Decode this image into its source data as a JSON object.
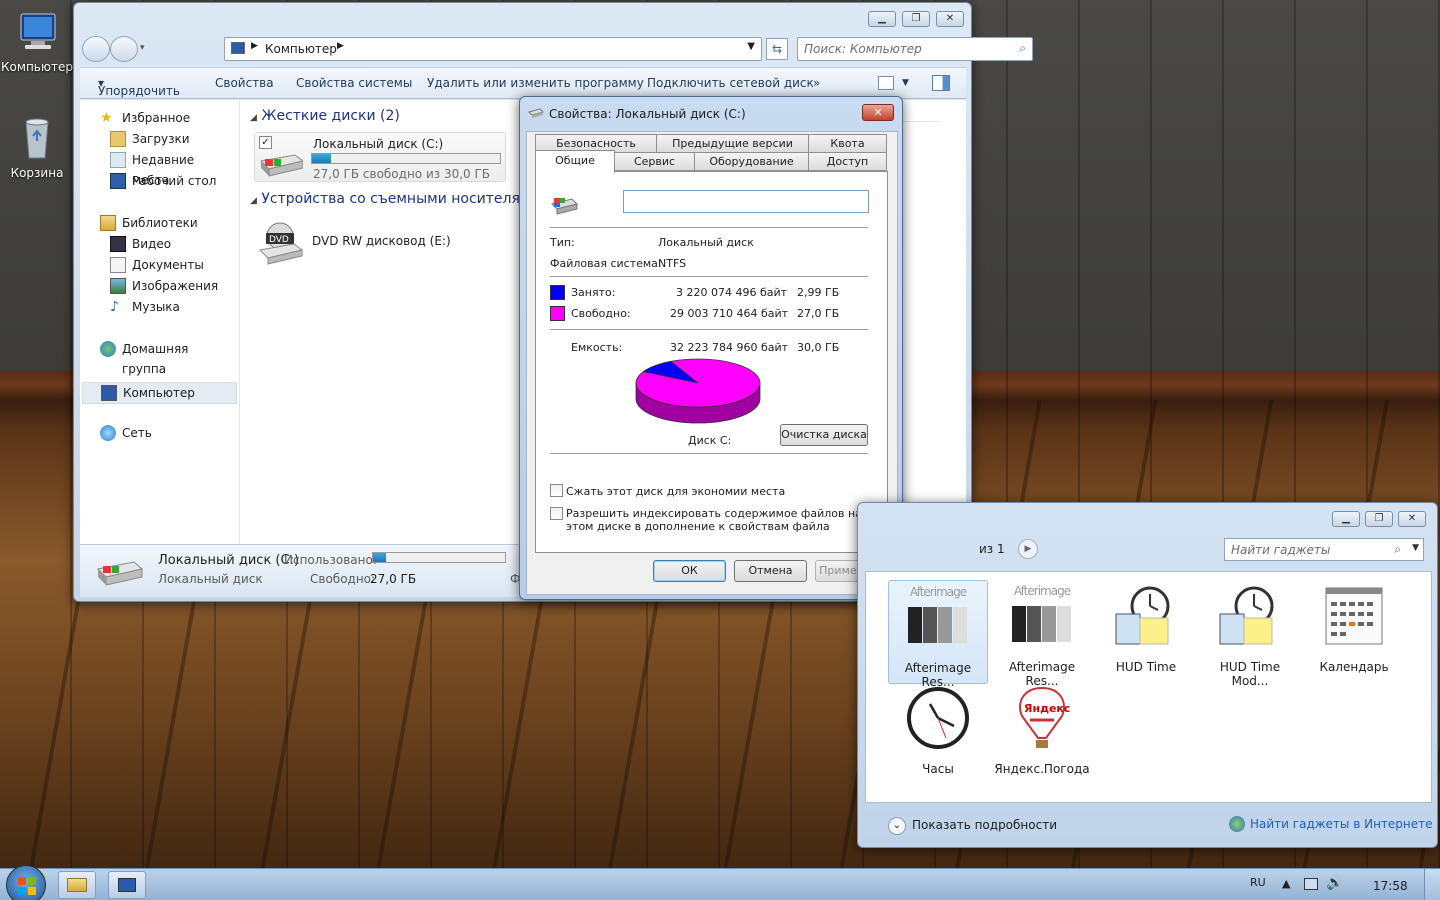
{
  "desktop": {
    "icons": [
      {
        "label": "Компьютер",
        "icon": "computer-icon"
      },
      {
        "label": "Корзина",
        "icon": "recycle-bin-icon"
      }
    ]
  },
  "explorer": {
    "breadcrumb": "Компьютер",
    "search_placeholder": "Поиск: Компьютер",
    "toolbar": [
      "Упорядочить",
      "Свойства",
      "Свойства системы",
      "Удалить или изменить программу",
      "Подключить сетевой диск",
      "»"
    ],
    "nav": {
      "favorites": "Избранное",
      "fav_items": [
        "Загрузки",
        "Недавние места",
        "Рабочий стол"
      ],
      "libraries": "Библиотеки",
      "lib_items": [
        "Видео",
        "Документы",
        "Изображения",
        "Музыка"
      ],
      "homegroup": "Домашняя группа",
      "computer": "Компьютер",
      "network": "Сеть"
    },
    "groups": {
      "hdd": "Жесткие диски (2)",
      "removable": "Устройства со съемными носителям"
    },
    "drive_c": {
      "name": "Локальный диск (C:)",
      "free_text": "27,0 ГБ свободно из 30,0 ГБ",
      "used_fraction": 0.1
    },
    "dvd": {
      "name": "DVD RW дисковод (E:)",
      "badge": "DVD"
    },
    "details": {
      "name": "Локальный диск (C:)",
      "type": "Локальный диск",
      "used_label": "Использовано:",
      "free_label": "Свободно:",
      "free_value": "27,0 ГБ",
      "cut": "Ф"
    }
  },
  "dialog": {
    "title": "Свойства: Локальный диск (C:)",
    "tabs_row1": [
      "Безопасность",
      "Предыдущие версии",
      "Квота"
    ],
    "tabs_row2": [
      "Общие",
      "Сервис",
      "Оборудование",
      "Доступ"
    ],
    "name_value": "",
    "type_label": "Тип:",
    "type_value": "Локальный диск",
    "fs_label": "Файловая система:",
    "fs_value": "NTFS",
    "used_label": "Занято:",
    "used_bytes": "3 220 074 496 байт",
    "used_gb": "2,99 ГБ",
    "free_label": "Свободно:",
    "free_bytes": "29 003 710 464 байт",
    "free_gb": "27,0 ГБ",
    "cap_label": "Емкость:",
    "cap_bytes": "32 223 784 960 байт",
    "cap_gb": "30,0 ГБ",
    "disk_label": "Диск C:",
    "cleanup": "Очистка диска",
    "compress": "Сжать этот диск для экономии места",
    "index": "Разрешить индексировать содержимое файлов на этом диске в дополнение к свойствам файла",
    "ok": "ОК",
    "cancel": "Отмена",
    "apply": "Применить",
    "used_color": "#0000ff",
    "free_color": "#ff00ff",
    "used_fraction": 0.1
  },
  "gadgets": {
    "page": "из 1",
    "search_placeholder": "Найти гаджеты",
    "items": [
      "Afterimage Res...",
      "Afterimage Res...",
      "HUD Time",
      "HUD Time Mod...",
      "Календарь",
      "Часы",
      "Яндекс.Погода"
    ],
    "watermark": "Afterimage",
    "yandex_word": "Яндекс",
    "show_details": "Показать подробности",
    "find_online": "Найти гаджеты в Интернете"
  },
  "taskbar": {
    "lang": "RU",
    "time": "17:58"
  }
}
